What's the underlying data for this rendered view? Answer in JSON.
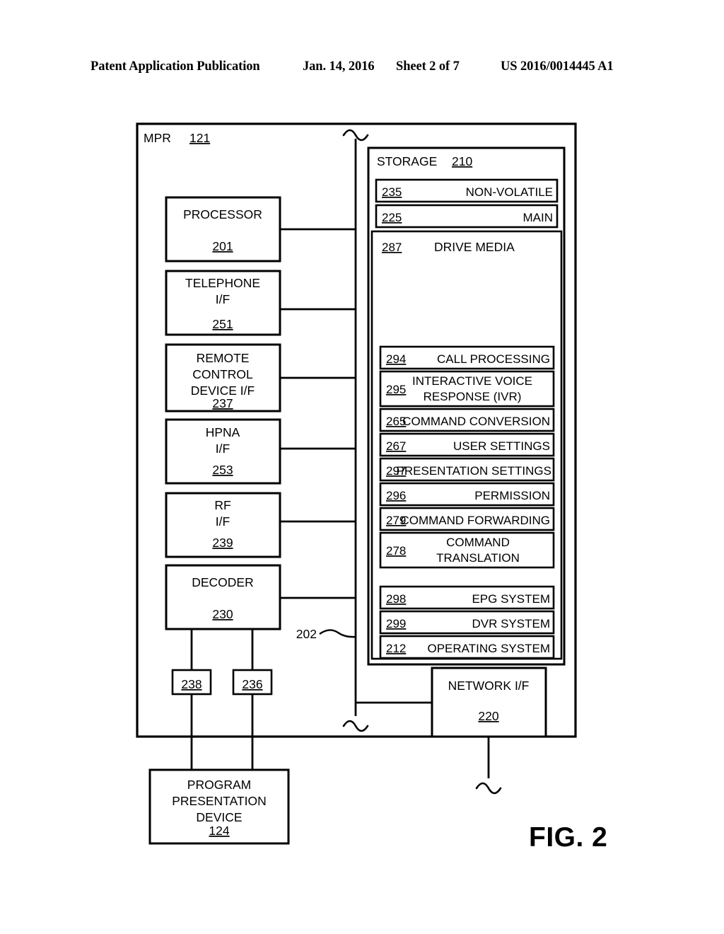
{
  "header": {
    "publication": "Patent Application Publication",
    "date": "Jan. 14, 2016",
    "sheet": "Sheet 2 of 7",
    "number": "US 2016/0014445 A1"
  },
  "figure": {
    "caption": "FIG. 2",
    "enclosure": {
      "label": "MPR",
      "ref": "121"
    },
    "bus": {
      "ref": "202"
    },
    "left_blocks": [
      {
        "ref": "201",
        "lines": [
          "PROCESSOR"
        ],
        "spaced": true
      },
      {
        "ref": "251",
        "lines": [
          "TELEPHONE",
          "I/F"
        ],
        "spaced": false
      },
      {
        "ref": "237",
        "lines": [
          "REMOTE",
          "CONTROL",
          "DEVICE I/F"
        ],
        "spaced": false
      },
      {
        "ref": "253",
        "lines": [
          "HPNA",
          "I/F"
        ],
        "spaced": false
      },
      {
        "ref": "239",
        "lines": [
          "RF",
          "I/F"
        ],
        "spaced": false
      },
      {
        "ref": "230",
        "lines": [
          "DECODER"
        ],
        "spaced": true
      }
    ],
    "small_blocks": [
      {
        "ref": "238"
      },
      {
        "ref": "236"
      }
    ],
    "network_interface": {
      "ref": "220",
      "lines": [
        "NETWORK I/F"
      ]
    },
    "presentation_device": {
      "ref": "124",
      "lines": [
        "PROGRAM",
        "PRESENTATION",
        "DEVICE"
      ]
    },
    "storage": {
      "label": "STORAGE",
      "ref": "210",
      "memories": [
        {
          "ref": "235",
          "label": "NON-VOLATILE"
        },
        {
          "ref": "225",
          "label": "MAIN"
        }
      ],
      "drive_media": {
        "ref": "287",
        "label": "DRIVE MEDIA",
        "modules": [
          {
            "ref": "294",
            "lines": [
              "CALL PROCESSING"
            ],
            "align": "right"
          },
          {
            "ref": "295",
            "lines": [
              "INTERACTIVE VOICE",
              "RESPONSE (IVR)"
            ],
            "align": "center"
          },
          {
            "ref": "265",
            "lines": [
              "COMMAND CONVERSION"
            ],
            "align": "right"
          },
          {
            "ref": "267",
            "lines": [
              "USER SETTINGS"
            ],
            "align": "right"
          },
          {
            "ref": "297",
            "lines": [
              "PRESENTATION SETTINGS"
            ],
            "align": "right"
          },
          {
            "ref": "296",
            "lines": [
              "PERMISSION"
            ],
            "align": "right"
          },
          {
            "ref": "279",
            "lines": [
              "COMMAND FORWARDING"
            ],
            "align": "right"
          },
          {
            "ref": "278",
            "lines": [
              "COMMAND",
              "TRANSLATION"
            ],
            "align": "center"
          }
        ],
        "systems": [
          {
            "ref": "298",
            "label": "EPG SYSTEM"
          },
          {
            "ref": "299",
            "label": "DVR SYSTEM"
          },
          {
            "ref": "212",
            "label": "OPERATING SYSTEM"
          }
        ]
      }
    }
  }
}
